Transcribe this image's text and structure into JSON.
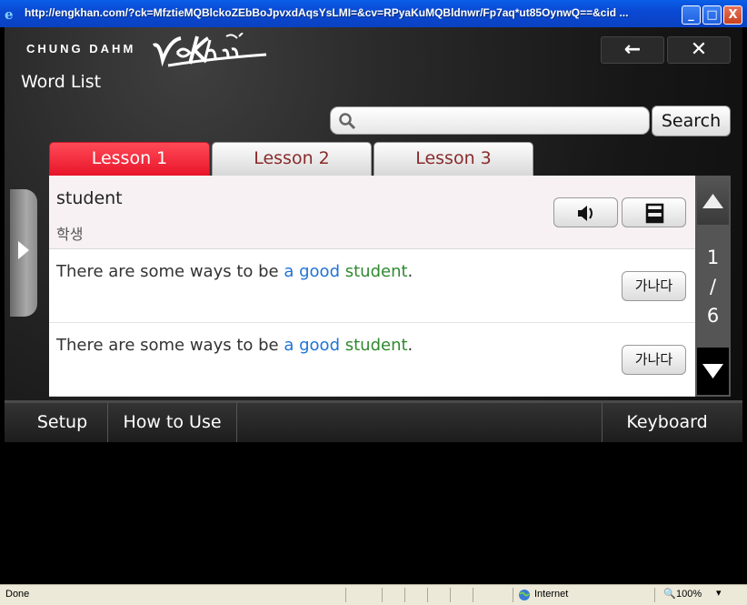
{
  "window": {
    "title": "http://engkhan.com/?ck=MfztieMQBlckoZEbBoJpvxdAqsYsLMI=&cv=RPyaKuMQBldnwr/Fp7aq*ut85OynwQ==&cid ...",
    "minimize": "_",
    "maximize": "□",
    "close": "X"
  },
  "header": {
    "brand": "CHUNG DAHM",
    "back": "←",
    "close": "✕"
  },
  "page": {
    "title": "Word List"
  },
  "search": {
    "value": "",
    "placeholder": "",
    "button": "Search"
  },
  "tabs": [
    {
      "label": "Lesson 1",
      "active": true
    },
    {
      "label": "Lesson 2",
      "active": false
    },
    {
      "label": "Lesson 3",
      "active": false
    }
  ],
  "word_entry": {
    "word": "student",
    "meaning": "학생"
  },
  "sentences": [
    {
      "plain": "There are some ways to be ",
      "blue": "a good",
      "green": "student",
      "end": ".",
      "translate": "가나다"
    },
    {
      "plain": "There are some ways to be ",
      "blue": "a good",
      "green": "student",
      "end": ".",
      "translate": "가나다"
    }
  ],
  "pager": {
    "current": "1",
    "sep": "/",
    "total": "6"
  },
  "toolbar": {
    "setup": "Setup",
    "howto": "How to Use",
    "keyboard": "Keyboard"
  },
  "status": {
    "left": "Done",
    "zone": "Internet",
    "zoom": "100%"
  },
  "colors": {
    "tab_active": "#e8142a",
    "blue_text": "#1f73d6",
    "green_text": "#2f8a2f",
    "title_bar": "#0a49d4"
  }
}
